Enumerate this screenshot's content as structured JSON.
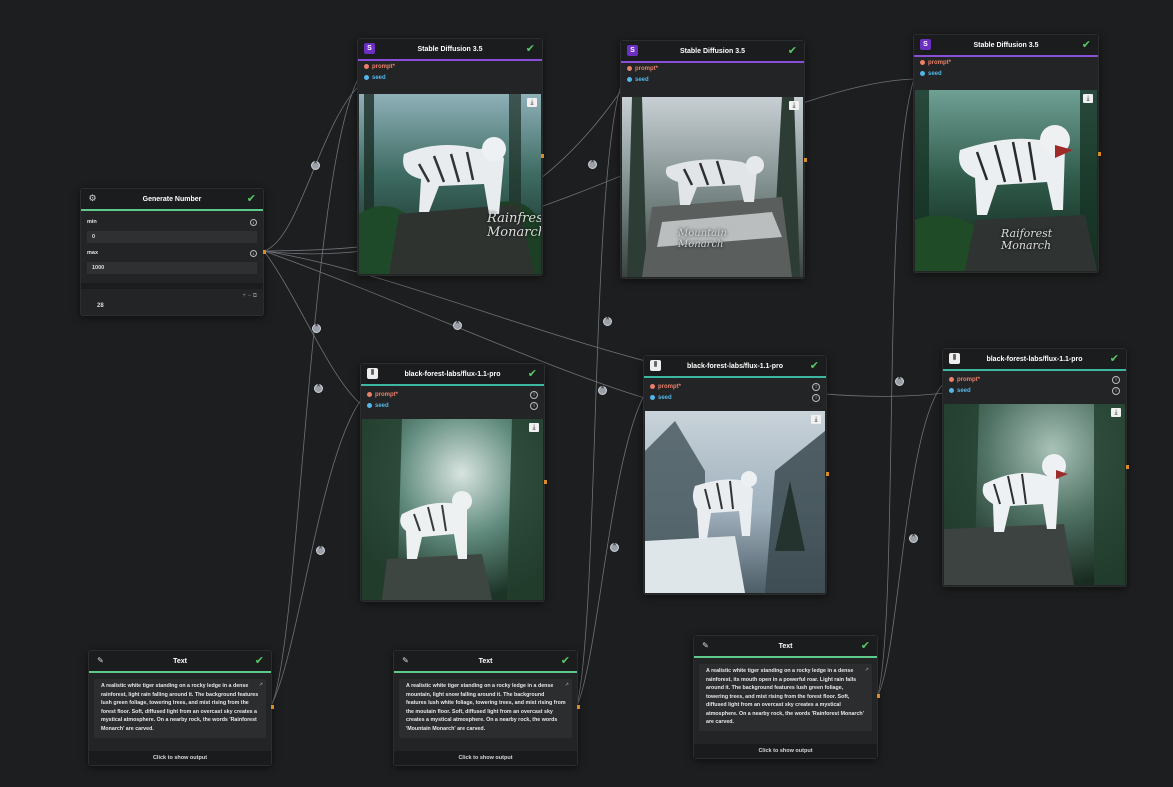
{
  "generate_number": {
    "title": "Generate Number",
    "min_label": "min",
    "min_value": "0",
    "max_label": "max",
    "max_value": "1000",
    "output_value": "28",
    "toolbar": "+ − ⧉"
  },
  "sd_nodes": [
    {
      "title": "Stable Diffusion 3.5",
      "icon": "S",
      "ports": [
        "prompt",
        "seed"
      ],
      "carving": "Rainfrest\nMonarch"
    },
    {
      "title": "Stable Diffusion 3.5",
      "icon": "S",
      "ports": [
        "prompt",
        "seed"
      ],
      "carving": "Mountain\nMonarch"
    },
    {
      "title": "Stable Diffusion 3.5",
      "icon": "S",
      "ports": [
        "prompt",
        "seed"
      ],
      "carving": "Raiforest Monarch"
    }
  ],
  "flux_nodes": [
    {
      "title": "black-forest-labs/flux-1.1-pro",
      "ports": [
        "prompt",
        "seed"
      ]
    },
    {
      "title": "black-forest-labs/flux-1.1-pro",
      "ports": [
        "prompt",
        "seed"
      ]
    },
    {
      "title": "black-forest-labs/flux-1.1-pro",
      "ports": [
        "prompt",
        "seed"
      ]
    }
  ],
  "text_nodes": [
    {
      "title": "Text",
      "content": "A realistic white tiger standing on a rocky ledge in a dense rainforest, light rain falling around it. The background features lush green foliage, towering trees, and mist rising from the forest floor. Soft, diffused light from an overcast sky creates a mystical atmosphere. On a nearby rock, the words 'Rainforest Monarch' are carved.",
      "button": "Click to show output"
    },
    {
      "title": "Text",
      "content": "A realistic white tiger standing on a rocky ledge in a dense mountain, light snow falling around it. The background features lush white foliage, towering trees, and mist rising from the moutain floor. Soft, diffused light from an overcast sky creates a mystical atmosphere. On a nearby rock, the words 'Mountain Monarch' are carved.",
      "button": "Click to show output"
    },
    {
      "title": "Text",
      "content": "A realistic white tiger standing on a rocky ledge in a dense rainforest, its mouth open in a powerful roar. Light rain falls around it. The background features lush green foliage, towering trees, and mist rising from the forest floor. Soft, diffused light from an overcast sky creates a mystical atmosphere. On a nearby rock, the words 'Rainforest Monarch' are carved.",
      "button": "Click to show output"
    }
  ],
  "icons": {
    "check": "check-icon",
    "download": "download-icon",
    "info": "info-icon",
    "pencil": "pencil-icon",
    "generate": "dice-icon",
    "flux": "flux-logo-icon",
    "sd": "stability-logo-icon",
    "external": "external-link-icon"
  },
  "colors": {
    "canvas": "#1d1e1f",
    "node": "#232425",
    "sd_accent": "#8a4fd8",
    "flux_accent": "#3db7a1",
    "text_accent": "#5ec98a",
    "check": "#58c767",
    "prompt_port": "#e8806a",
    "seed_port": "#54b6e8",
    "output_port": "#d98b2a"
  }
}
